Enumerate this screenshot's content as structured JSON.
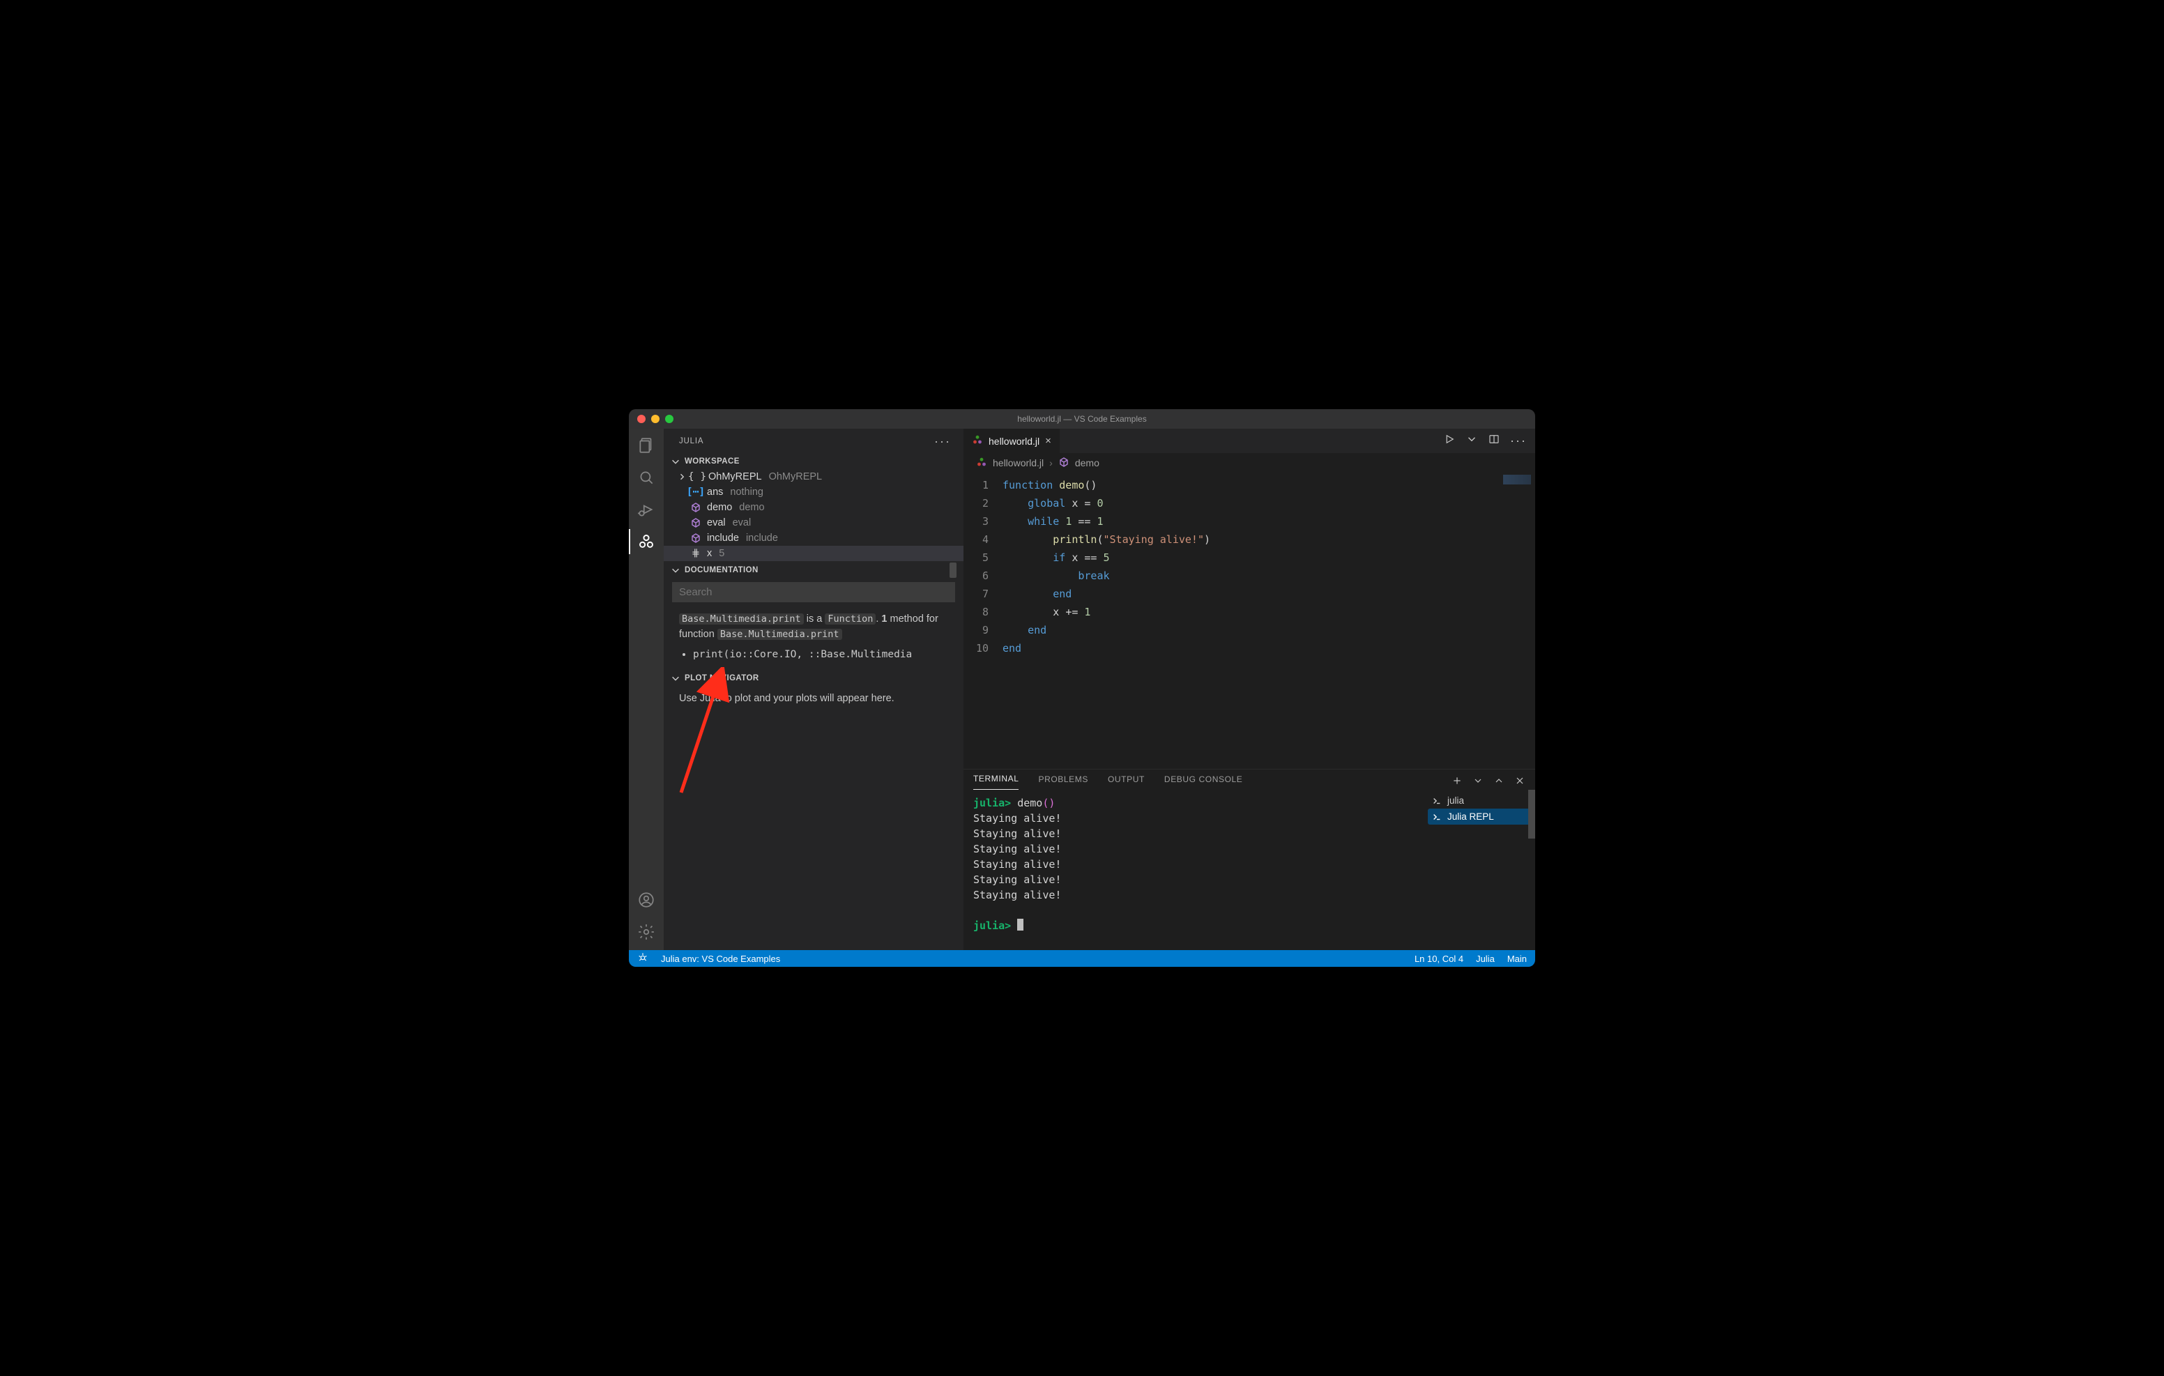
{
  "window": {
    "title": "helloworld.jl — VS Code Examples"
  },
  "sidebar": {
    "title": "JULIA",
    "sections": {
      "workspace": {
        "label": "WORKSPACE",
        "items": [
          {
            "name": "OhMyREPL",
            "type": "OhMyREPL",
            "icon": "braces",
            "chevron": true
          },
          {
            "name": "ans",
            "type": "nothing",
            "icon": "bracket-blue"
          },
          {
            "name": "demo",
            "type": "demo",
            "icon": "cube"
          },
          {
            "name": "eval",
            "type": "eval",
            "icon": "cube"
          },
          {
            "name": "include",
            "type": "include",
            "icon": "cube"
          },
          {
            "name": "x",
            "type": "5",
            "icon": "hash",
            "highlighted": true
          }
        ]
      },
      "documentation": {
        "label": "DOCUMENTATION",
        "search_placeholder": "Search",
        "body_prefix_code": "Base.Multimedia.print",
        "body_mid1": " is a ",
        "body_code2": "Function",
        "body_mid2": ". ",
        "body_bold": "1",
        "body_mid3": " method for function ",
        "body_code3": "Base.Multimedia.print",
        "bullet": "print(io::Core.IO, ::Base.Multimedia"
      },
      "plot": {
        "label": "PLOT NAVIGATOR",
        "body": "Use Julia to plot and your plots will appear here."
      }
    }
  },
  "tabs": [
    {
      "label": "helloworld.jl",
      "icon": "julia",
      "active": true
    }
  ],
  "breadcrumb": {
    "file": "helloworld.jl",
    "symbol": "demo"
  },
  "editor": {
    "lines": [
      {
        "n": 1,
        "html": "<span class='tk-kw'>function</span> <span class='tk-fn'>demo</span>()"
      },
      {
        "n": 2,
        "html": "    <span class='tk-kw'>global</span> x <span class='tk-op'>=</span> <span class='tk-num'>0</span>"
      },
      {
        "n": 3,
        "html": "    <span class='tk-kw'>while</span> <span class='tk-num'>1</span> <span class='tk-op'>==</span> <span class='tk-num'>1</span>"
      },
      {
        "n": 4,
        "html": "        <span class='tk-fn'>println</span>(<span class='tk-str'>\"Staying alive!\"</span>)"
      },
      {
        "n": 5,
        "html": "        <span class='tk-kw'>if</span> x <span class='tk-op'>==</span> <span class='tk-num'>5</span>"
      },
      {
        "n": 6,
        "html": "            <span class='tk-kw'>break</span>"
      },
      {
        "n": 7,
        "html": "        <span class='tk-kw'>end</span>"
      },
      {
        "n": 8,
        "html": "        x <span class='tk-op'>+=</span> <span class='tk-num'>1</span>"
      },
      {
        "n": 9,
        "html": "    <span class='tk-kw'>end</span>"
      },
      {
        "n": 10,
        "html": "<span class='tk-kw'>end</span>"
      }
    ]
  },
  "panel": {
    "tabs": {
      "terminal": "TERMINAL",
      "problems": "PROBLEMS",
      "output": "OUTPUT",
      "debug": "DEBUG CONSOLE"
    },
    "terminal": {
      "prompt": "julia>",
      "call": "demo",
      "output_line": "Staying alive!",
      "output_repeat": 6
    },
    "terminals_list": [
      {
        "label": "julia",
        "selected": false
      },
      {
        "label": "Julia REPL",
        "selected": true
      }
    ]
  },
  "status": {
    "env": "Julia env: VS Code Examples",
    "pos": "Ln 10, Col 4",
    "lang": "Julia",
    "branch": "Main"
  }
}
